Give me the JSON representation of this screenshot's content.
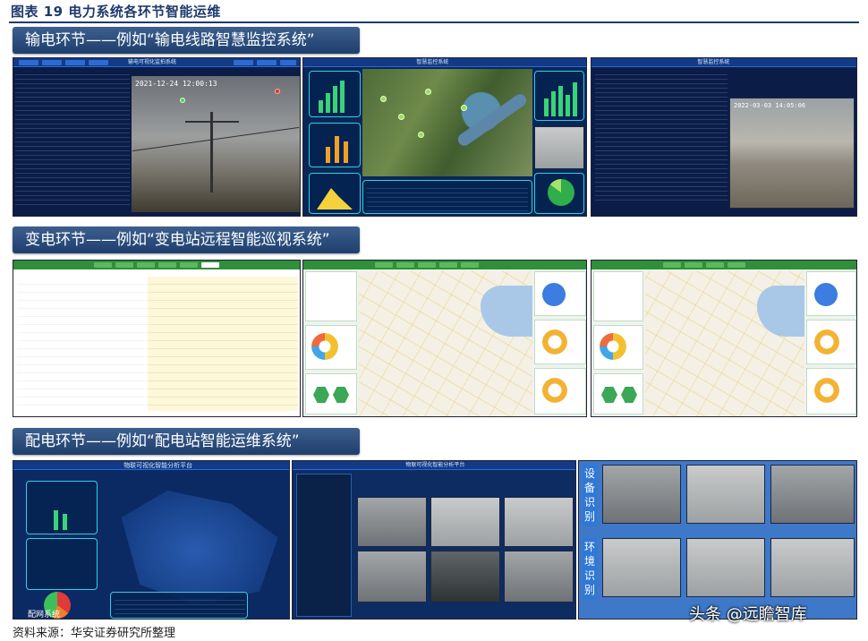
{
  "figure": {
    "title": "图表 19 电力系统各环节智能运维",
    "source": "资料来源：华安证券研究所整理",
    "watermark": "头条 @远瞻智库"
  },
  "sections": [
    {
      "label": "输电环节——例如“输电线路智慧监控系统”"
    },
    {
      "label": "变电环节——例如“变电站远程智能巡视系统”"
    },
    {
      "label": "配电环节——例如“配电站智能运维系统”"
    }
  ],
  "screens": {
    "transmission_camera": {
      "timestamp": "2021-12-24 12:00:13",
      "header": "输电可视化监拍系统"
    },
    "transmission_map": {
      "header": "智慧监控系统"
    },
    "transmission_site": {
      "header": "智慧监控系统",
      "timestamp": "2022-03-03 14:05:06"
    },
    "distribution_platform": {
      "header": "物联可视化智能分析平台",
      "corner_label": "配网系统"
    },
    "distribution_video": {
      "header": "物联可视化智能分析平台"
    },
    "distribution_grid": {
      "labels": [
        "设备识别",
        "环境识别"
      ]
    }
  }
}
